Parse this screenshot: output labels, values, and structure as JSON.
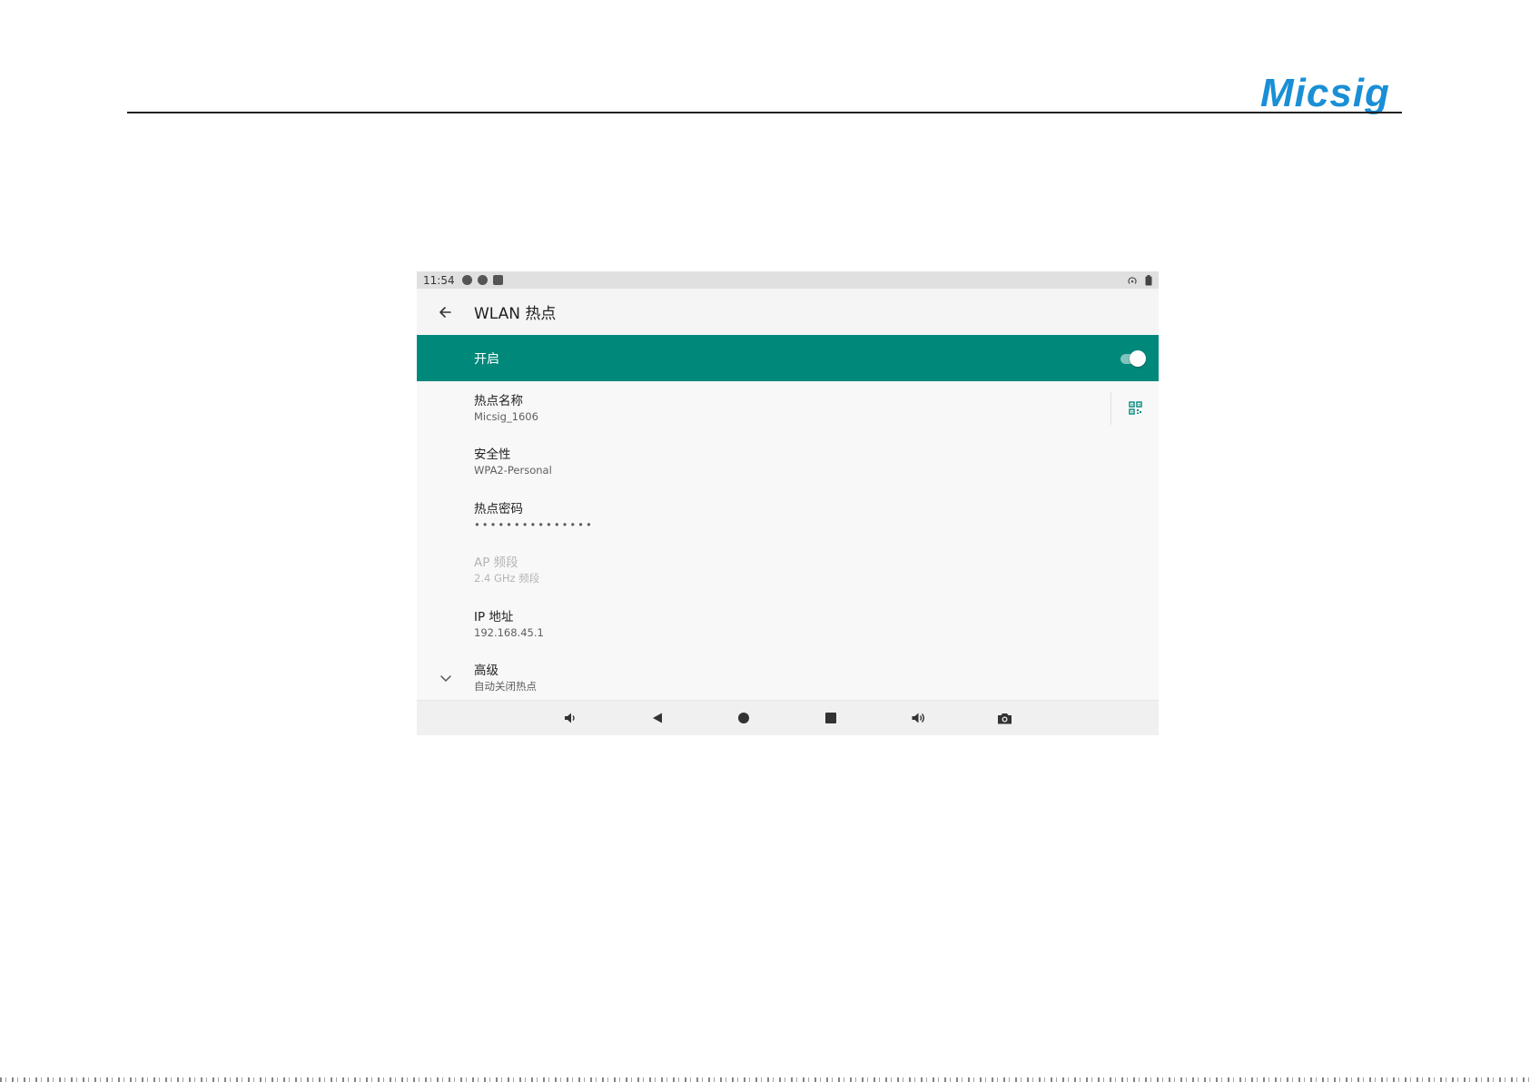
{
  "header": {
    "logo_text": "Micsig",
    "logo_color": "#1a8fd6"
  },
  "statusbar": {
    "time": "11:54",
    "left_icons": [
      "notification-icon",
      "notification-icon",
      "sd-card-icon"
    ],
    "right_icons": [
      "hotspot-icon",
      "battery-icon"
    ]
  },
  "appbar": {
    "title": "WLAN 热点",
    "back_icon": "arrow-left-icon"
  },
  "master_switch": {
    "label": "开启",
    "state": "on",
    "accent_color": "#00897b"
  },
  "prefs": {
    "ssid": {
      "title": "热点名称",
      "summary": "Micsig_1606",
      "trailing_icon": "qr-code-icon"
    },
    "security": {
      "title": "安全性",
      "summary": "WPA2-Personal"
    },
    "password": {
      "title": "热点密码",
      "summary": "•••••••••••••••"
    },
    "band": {
      "title": "AP 频段",
      "summary": "2.4 GHz 频段",
      "enabled": false
    },
    "ip": {
      "title": "IP 地址",
      "summary": "192.168.45.1"
    },
    "advanced": {
      "title": "高级",
      "summary": "自动关闭热点",
      "lead_icon": "chevron-down-icon"
    }
  },
  "navbar": {
    "buttons": [
      "volume-down-icon",
      "back-triangle-icon",
      "home-circle-icon",
      "recents-square-icon",
      "volume-up-icon",
      "camera-icon"
    ]
  }
}
